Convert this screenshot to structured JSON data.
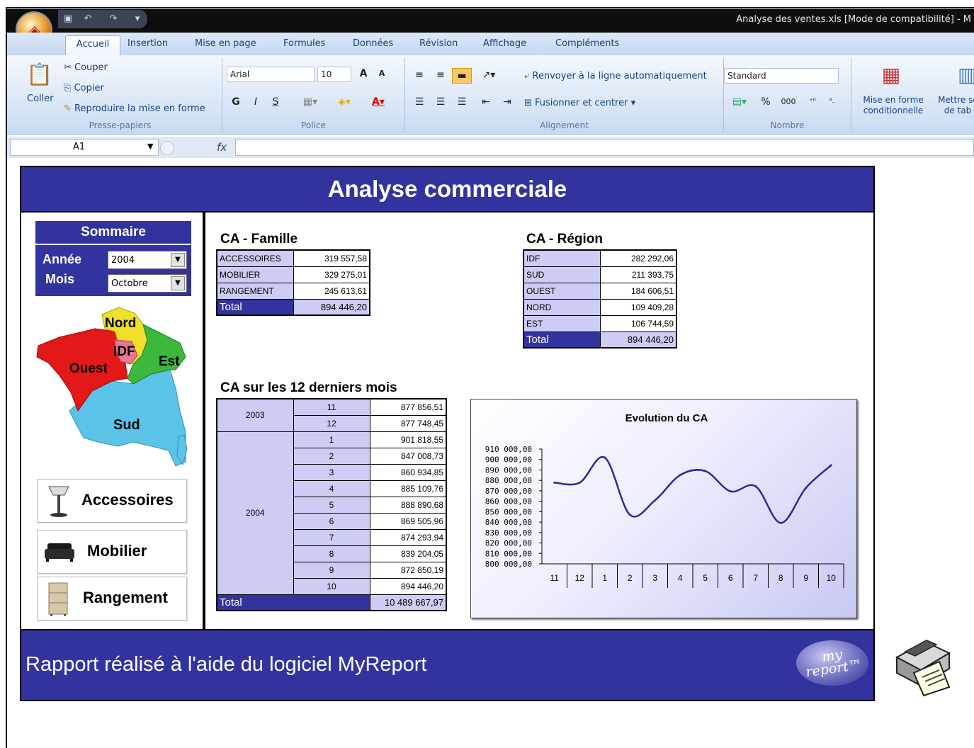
{
  "window": {
    "title": "Analyse des ventes.xls  [Mode de compatibilité] - M"
  },
  "ribbon": {
    "tabs": [
      "Accueil",
      "Insertion",
      "Mise en page",
      "Formules",
      "Données",
      "Révision",
      "Affichage",
      "Compléments"
    ],
    "clipboard": {
      "paste": "Coller",
      "cut": "Couper",
      "copy": "Copier",
      "format_painter": "Reproduire la mise en forme",
      "group": "Presse-papiers"
    },
    "font": {
      "name": "Arial",
      "size": "10",
      "bold": "G",
      "italic": "I",
      "underline": "S",
      "group": "Police"
    },
    "alignment": {
      "wrap": "Renvoyer à la ligne automatiquement",
      "merge": "Fusionner et centrer",
      "group": "Alignement"
    },
    "number": {
      "format": "Standard",
      "percent": "%",
      "thousands": "000",
      "group": "Nombre"
    },
    "styles": {
      "conditional": "Mise en forme conditionnelle",
      "table": "Mettre sc de tab"
    }
  },
  "formula_bar": {
    "cell_ref": "A1",
    "fx": "fx"
  },
  "dashboard": {
    "title": "Analyse commerciale",
    "footer": "Rapport réalisé à l'aide du logiciel MyReport",
    "logo": "my report™",
    "summary": {
      "title": "Sommaire",
      "year_label": "Année",
      "year_value": "2004",
      "month_label": "Mois",
      "month_value": "Octobre"
    },
    "map": {
      "regions": [
        "Nord",
        "IDF",
        "Est",
        "Ouest",
        "Sud"
      ]
    },
    "categories": [
      "Accessoires",
      "Mobilier",
      "Rangement"
    ],
    "famille": {
      "title": "CA - Famille",
      "rows": [
        {
          "label": "ACCESSOIRES",
          "value": "319 557,58"
        },
        {
          "label": "MOBILIER",
          "value": "329 275,01"
        },
        {
          "label": "RANGEMENT",
          "value": "245 613,61"
        }
      ],
      "total_label": "Total",
      "total_value": "894 446,20"
    },
    "region": {
      "title": "CA - Région",
      "rows": [
        {
          "label": "IDF",
          "value": "282 292,06"
        },
        {
          "label": "SUD",
          "value": "211 393,75"
        },
        {
          "label": "OUEST",
          "value": "184 606,51"
        },
        {
          "label": "NORD",
          "value": "109 409,28"
        },
        {
          "label": "EST",
          "value": "106 744,59"
        }
      ],
      "total_label": "Total",
      "total_value": "894 446,20"
    },
    "months12": {
      "title": "CA sur les 12 derniers mois",
      "rows": [
        {
          "year": "2003",
          "month": "11",
          "value": "877 856,51"
        },
        {
          "year": "",
          "month": "12",
          "value": "877 748,45"
        },
        {
          "year": "2004",
          "month": "1",
          "value": "901 818,55"
        },
        {
          "year": "",
          "month": "2",
          "value": "847 008,73"
        },
        {
          "year": "",
          "month": "3",
          "value": "860 934,85"
        },
        {
          "year": "",
          "month": "4",
          "value": "885 109,76"
        },
        {
          "year": "",
          "month": "5",
          "value": "888 890,68"
        },
        {
          "year": "",
          "month": "6",
          "value": "869 505,96"
        },
        {
          "year": "",
          "month": "7",
          "value": "874 293,94"
        },
        {
          "year": "",
          "month": "8",
          "value": "839 204,05"
        },
        {
          "year": "",
          "month": "9",
          "value": "872 850,19"
        },
        {
          "year": "",
          "month": "10",
          "value": "894 446,20"
        }
      ],
      "total_label": "Total",
      "total_value": "10 489 667,97"
    }
  },
  "chart_data": {
    "type": "line",
    "title": "Evolution du CA",
    "categories": [
      "11",
      "12",
      "1",
      "2",
      "3",
      "4",
      "5",
      "6",
      "7",
      "8",
      "9",
      "10"
    ],
    "series": [
      {
        "values": [
          877856.51,
          877748.45,
          901818.55,
          847008.73,
          860934.85,
          885109.76,
          888890.68,
          869505.96,
          874293.94,
          839204.05,
          872850.19,
          894446.2
        ]
      }
    ],
    "ylim": [
      800000,
      910000
    ],
    "yticks": [
      "910 000,00",
      "900 000,00",
      "890 000,00",
      "880 000,00",
      "870 000,00",
      "860 000,00",
      "850 000,00",
      "840 000,00",
      "830 000,00",
      "820 000,00",
      "810 000,00",
      "800 000,00"
    ],
    "line_color": "#2a2a9a"
  }
}
